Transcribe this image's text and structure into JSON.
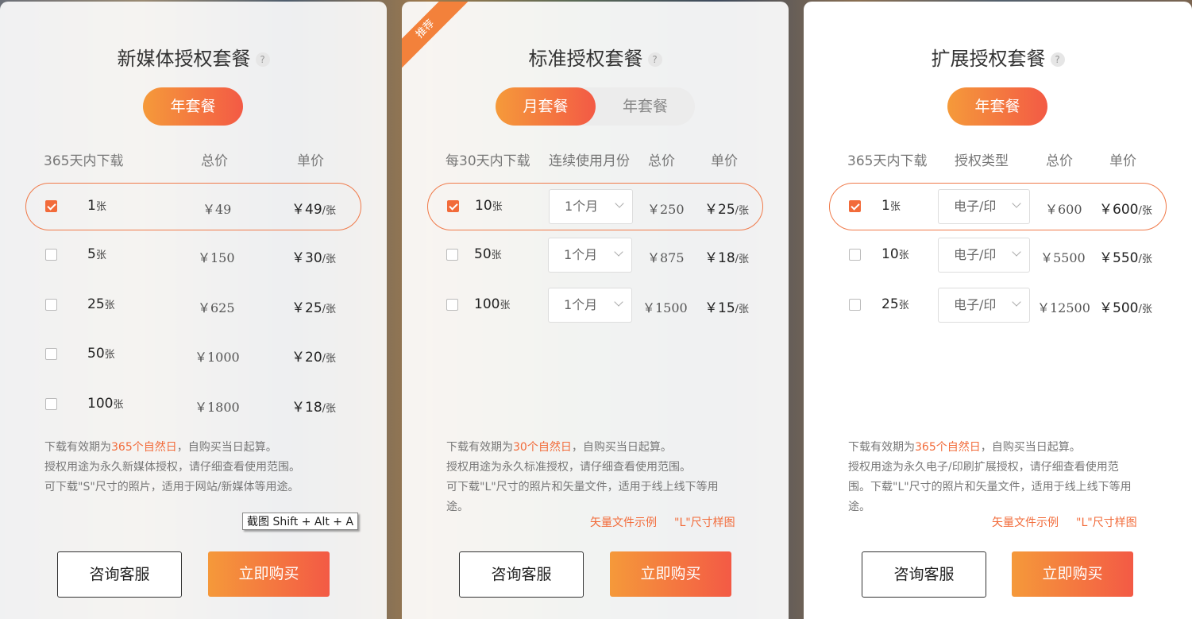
{
  "cards": [
    {
      "title": "新媒体授权套餐",
      "help": "?",
      "pill": "年套餐",
      "headers": [
        "365天内下载",
        "总价",
        "单价"
      ],
      "rows": [
        {
          "qty": "1",
          "qty_unit": "张",
          "total": "￥49",
          "unit": "￥49",
          "unit_suffix": "/张",
          "checked": true
        },
        {
          "qty": "5",
          "qty_unit": "张",
          "total": "￥150",
          "unit": "￥30",
          "unit_suffix": "/张",
          "checked": false
        },
        {
          "qty": "25",
          "qty_unit": "张",
          "total": "￥625",
          "unit": "￥25",
          "unit_suffix": "/张",
          "checked": false
        },
        {
          "qty": "50",
          "qty_unit": "张",
          "total": "￥1000",
          "unit": "￥20",
          "unit_suffix": "/张",
          "checked": false
        },
        {
          "qty": "100",
          "qty_unit": "张",
          "total": "￥1800",
          "unit": "￥18",
          "unit_suffix": "/张",
          "checked": false
        }
      ],
      "note": {
        "l1_a": "下载有效期为",
        "l1_hl": "365个自然日",
        "l1_b": "，自购买当日起算。",
        "l2": "授权用途为永久新媒体授权，请仔细查看使用范围。",
        "l3": "可下载\"S\"尺寸的照片，适用于网站/新媒体等用途。"
      },
      "consult": "咨询客服",
      "buy": "立即购买"
    },
    {
      "title": "标准授权套餐",
      "help": "?",
      "ribbon": "推荐",
      "toggle": {
        "active": "月套餐",
        "inactive": "年套餐"
      },
      "headers": [
        "每30天内下载",
        "连续使用月份",
        "总价",
        "单价"
      ],
      "rows": [
        {
          "qty": "10",
          "qty_unit": "张",
          "select": "1个月",
          "total": "￥250",
          "unit": "￥25",
          "unit_suffix": "/张",
          "checked": true
        },
        {
          "qty": "50",
          "qty_unit": "张",
          "select": "1个月",
          "total": "￥875",
          "unit": "￥18",
          "unit_suffix": "/张",
          "checked": false
        },
        {
          "qty": "100",
          "qty_unit": "张",
          "select": "1个月",
          "total": "￥1500",
          "unit": "￥15",
          "unit_suffix": "/张",
          "checked": false
        }
      ],
      "note": {
        "l1_a": "下载有效期为",
        "l1_hl": "30个自然日",
        "l1_b": "，自购买当日起算。",
        "l2": "授权用途为永久标准授权，请仔细查看使用范围。",
        "l3": "可下载\"L\"尺寸的照片和矢量文件，适用于线上线下等用",
        "l4": "途。"
      },
      "links": [
        "矢量文件示例",
        "\"L\"尺寸样图"
      ],
      "consult": "咨询客服",
      "buy": "立即购买"
    },
    {
      "title": "扩展授权套餐",
      "help": "?",
      "pill": "年套餐",
      "headers": [
        "365天内下载",
        "授权类型",
        "总价",
        "单价"
      ],
      "rows": [
        {
          "qty": "1",
          "qty_unit": "张",
          "select": "电子/印",
          "total": "￥600",
          "unit": "￥600",
          "unit_suffix": "/张",
          "checked": true
        },
        {
          "qty": "10",
          "qty_unit": "张",
          "select": "电子/印",
          "total": "￥5500",
          "unit": "￥550",
          "unit_suffix": "/张",
          "checked": false
        },
        {
          "qty": "25",
          "qty_unit": "张",
          "select": "电子/印",
          "total": "￥12500",
          "unit": "￥500",
          "unit_suffix": "/张",
          "checked": false
        }
      ],
      "note": {
        "l1_a": "下载有效期为",
        "l1_hl": "365个自然日",
        "l1_b": "，自购买当日起算。",
        "l2": "授权用途为永久电子/印刷扩展授权，请仔细查看使用范",
        "l3": "围。下载\"L\"尺寸的照片和矢量文件，适用于线上线下等用",
        "l4": "途。"
      },
      "links": [
        "矢量文件示例",
        "\"L\"尺寸样图"
      ],
      "consult": "咨询客服",
      "buy": "立即购买"
    }
  ],
  "tooltip": "截图 Shift + Alt + A",
  "colors": {
    "accent": "#f26b3a",
    "gradient_start": "#f5993a",
    "gradient_end": "#f35a45"
  }
}
